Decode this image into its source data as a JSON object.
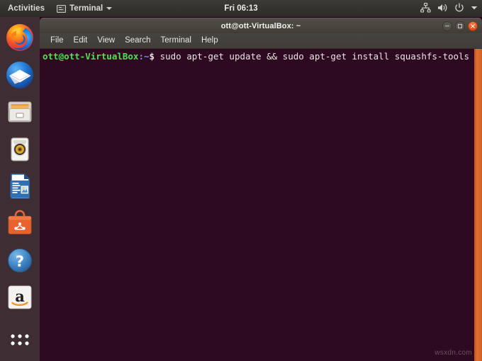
{
  "top_bar": {
    "activities_label": "Activities",
    "window_menu_label": "Terminal",
    "window_menu_icon": "terminal-icon",
    "clock": "Fri 06:13",
    "tray": [
      {
        "name": "network-icon",
        "label": "Network"
      },
      {
        "name": "volume-icon",
        "label": "Volume"
      },
      {
        "name": "power-icon",
        "label": "Power"
      },
      {
        "name": "chevron-down-icon",
        "label": "System menu"
      }
    ]
  },
  "launcher": {
    "items": [
      {
        "name": "launcher-item-firefox",
        "label": "Firefox Web Browser",
        "icon": "firefox-icon"
      },
      {
        "name": "launcher-item-thunderbird",
        "label": "Thunderbird Mail",
        "icon": "thunderbird-icon"
      },
      {
        "name": "launcher-item-files",
        "label": "Files",
        "icon": "files-icon"
      },
      {
        "name": "launcher-item-rhythmbox",
        "label": "Rhythmbox",
        "icon": "rhythmbox-icon"
      },
      {
        "name": "launcher-item-libreoffice-writer",
        "label": "LibreOffice Writer",
        "icon": "libreoffice-writer-icon"
      },
      {
        "name": "launcher-item-ubuntu-software",
        "label": "Ubuntu Software",
        "icon": "ubuntu-software-icon"
      },
      {
        "name": "launcher-item-help",
        "label": "Help",
        "icon": "help-icon"
      },
      {
        "name": "launcher-item-amazon",
        "label": "Amazon",
        "icon": "amazon-icon"
      },
      {
        "name": "launcher-item-show-applications",
        "label": "Show Applications",
        "icon": "app-grid-icon"
      }
    ]
  },
  "terminal": {
    "title": "ott@ott-VirtualBox: ~",
    "menu": [
      {
        "name": "menu-file",
        "label": "File"
      },
      {
        "name": "menu-edit",
        "label": "Edit"
      },
      {
        "name": "menu-view",
        "label": "View"
      },
      {
        "name": "menu-search",
        "label": "Search"
      },
      {
        "name": "menu-terminal",
        "label": "Terminal"
      },
      {
        "name": "menu-help",
        "label": "Help"
      }
    ],
    "window_controls": [
      {
        "name": "minimize-button",
        "label": "Minimize"
      },
      {
        "name": "maximize-button",
        "label": "Maximize"
      },
      {
        "name": "close-button",
        "label": "Close"
      }
    ],
    "prompt_user": "ott@ott-VirtualBox",
    "prompt_path": ":~",
    "prompt_symbol": "$ ",
    "command": "sudo apt-get update && sudo apt-get install squashfs-tools",
    "colors": {
      "background": "#2d0922",
      "prompt_user": "#4ee24e",
      "prompt_path": "#7b8cf0",
      "text": "#e8e3e0",
      "scrollbar": "#dd6b2b"
    }
  },
  "watermark": {
    "text": "wsxdn.com"
  }
}
